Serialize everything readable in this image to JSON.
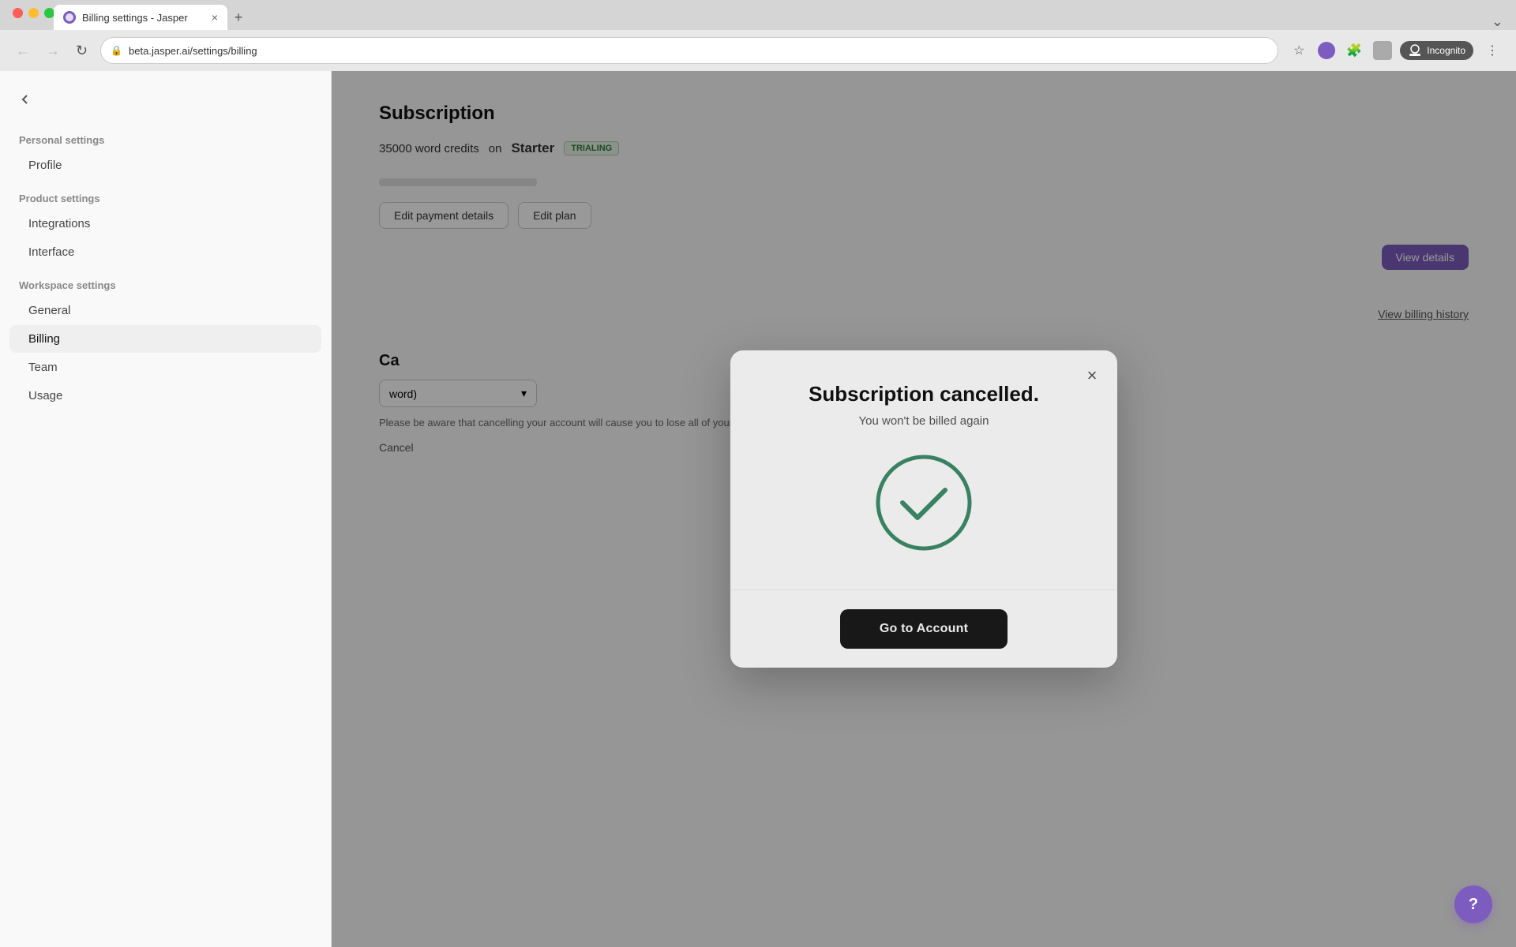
{
  "browser": {
    "tab_title": "Billing settings - Jasper",
    "tab_close": "×",
    "tab_new": "+",
    "address": "beta.jasper.ai/settings/billing",
    "incognito_label": "Incognito",
    "nav_back": "←",
    "nav_forward": "→",
    "nav_reload": "↻"
  },
  "sidebar": {
    "back_label": "",
    "personal_settings_header": "Personal settings",
    "profile_label": "Profile",
    "product_settings_header": "Product settings",
    "integrations_label": "Integrations",
    "interface_label": "Interface",
    "workspace_settings_header": "Workspace settings",
    "general_label": "General",
    "billing_label": "Billing",
    "team_label": "Team",
    "usage_label": "Usage"
  },
  "main": {
    "subscription_title": "Subscription",
    "word_credits": "35000 word credits",
    "on_label": "on",
    "plan_name": "Starter",
    "trialing_badge": "TRIALING",
    "edit_payment_label": "Edit payment details",
    "edit_plan_label": "Edit plan",
    "view_details_label": "View details",
    "view_billing_label": "View billing history",
    "cancel_title": "Ca",
    "cancel_warning": "Please be aware that cancelling your account will cause you to lose all of your saved content and earned credits on your account.",
    "cancel_btn": "Cancel",
    "dropdown_placeholder": "word)"
  },
  "modal": {
    "title": "Subscription cancelled.",
    "subtitle": "You won't be billed again",
    "close_label": "×",
    "go_to_account_label": "Go to Account",
    "check_circle_color": "#3d8c6b",
    "check_circle_bg": "transparent"
  },
  "help": {
    "label": "?"
  }
}
